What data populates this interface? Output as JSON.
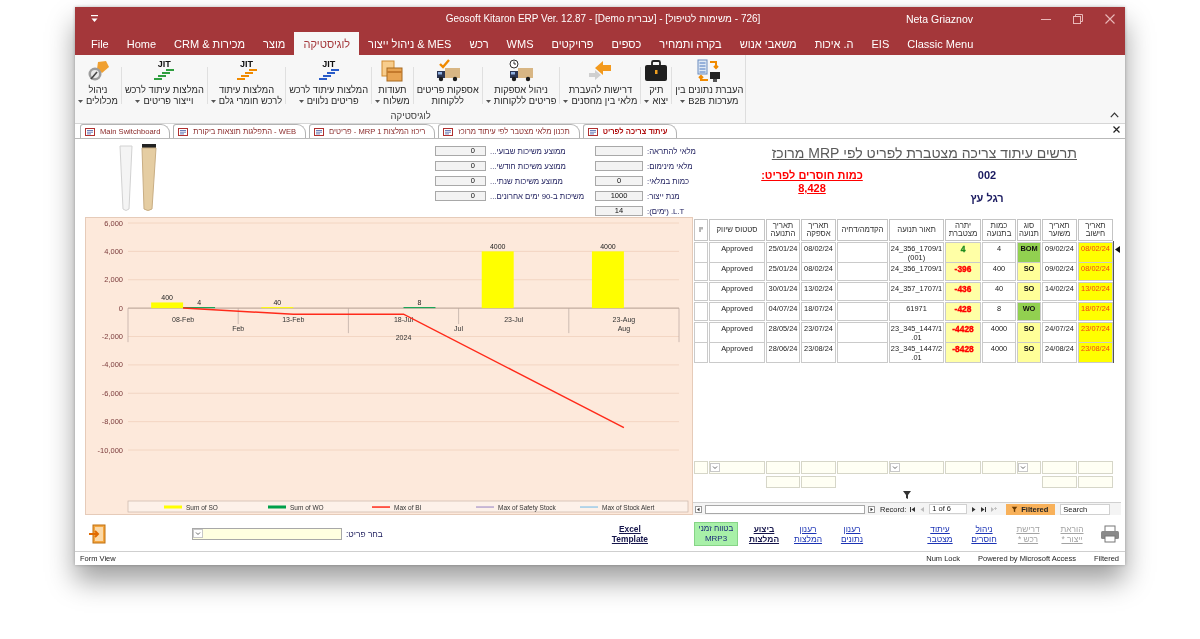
{
  "window": {
    "title": "Geosoft Kitaron ERP Ver. 12.87 - [Demo עברית] - [726 - משימות לטיפול]",
    "user": "Neta Griaznov"
  },
  "ribbon_tabs": [
    {
      "label": "Classic Menu",
      "selected": false
    },
    {
      "label": "EIS",
      "selected": false
    },
    {
      "label": "ה. איכות",
      "selected": false
    },
    {
      "label": "משאבי אנוש",
      "selected": false
    },
    {
      "label": "בקרה ותמחיר",
      "selected": false
    },
    {
      "label": "כספים",
      "selected": false
    },
    {
      "label": "פרויקטים",
      "selected": false
    },
    {
      "label": "WMS",
      "selected": false
    },
    {
      "label": "רכש",
      "selected": false
    },
    {
      "label": "ניהול ייצור & MES",
      "selected": false
    },
    {
      "label": "לוגיסטיקה",
      "selected": true
    },
    {
      "label": "מוצר",
      "selected": false
    },
    {
      "label": "CRM & מכירות",
      "selected": false
    },
    {
      "label": "Home",
      "selected": false
    },
    {
      "label": "File",
      "selected": false
    }
  ],
  "ribbon": {
    "buttons": [
      {
        "label": "העברת נתונים בין\nמערכות B2B",
        "has_menu": true
      },
      {
        "label": "תיק\nיצוא",
        "has_menu": true
      },
      {
        "label": "דרישות להעברת\nמלאי בין מחסנים",
        "has_menu": true
      },
      {
        "label": "ניהול אספקות\nפריטים ללקוחות",
        "has_menu": true
      },
      {
        "label": "אספקות פריטים\nללקוחות",
        "has_menu": false
      },
      {
        "label": "תעודות\nמשלוח",
        "has_menu": true
      },
      {
        "label": "המלצות עיתוד לרכש\nפריטים נלווים",
        "has_menu": true,
        "badge": "JIT",
        "color": "#2a5cc8"
      },
      {
        "label": "המלצות עיתוד\nלרכש חומרי גלם",
        "has_menu": true,
        "badge": "JIT",
        "color": "#f08a00"
      },
      {
        "label": "המלצות עיתוד לרכש\nוייצור פריטים",
        "has_menu": true,
        "badge": "JIT",
        "color": "#2f9e3f"
      },
      {
        "label": "ניהול\nמכלולים",
        "has_menu": true
      }
    ],
    "group_label": "לוגיסטיקה"
  },
  "doc_tabs": [
    {
      "label": "עיתוד צריכה לפריט",
      "selected": true
    },
    {
      "label": "תכנון מלאי מצטבר לפי עיתוד מרוכז",
      "selected": false
    },
    {
      "label": "ריכוז המלצות MRP 1 - פריטים",
      "selected": false
    },
    {
      "label": "WEB - התפלגות תוצאות ביקורת",
      "selected": false
    },
    {
      "label": "Main Switchboard",
      "selected": false
    }
  ],
  "usage_fields": [
    {
      "label": "ממוצע משיכות שבועי...",
      "value": "0"
    },
    {
      "label": "ממוצע משיכות חודשי...",
      "value": "0"
    },
    {
      "label": "ממוצע משיכות שנתי...",
      "value": "0"
    },
    {
      "label": "משיכות ב-90 ימים אחרונים...",
      "value": "0"
    }
  ],
  "stock_fields": [
    {
      "label": "מלאי להתראה:"
    },
    {
      "label": "מלאי מינימום:"
    },
    {
      "label": "כמות במלאי:",
      "value": "0"
    },
    {
      "label": "מנת ייצור:",
      "value": "1000"
    },
    {
      "label": "L.T. (ימים):",
      "value": "14"
    }
  ],
  "item_panel": {
    "title": "תרשים עיתוד צריכה מצטברת לפריט לפי MRP מרוכז",
    "shortage_label": "כמות חוסרים לפריט:",
    "shortage_value": "8,428",
    "item_code": "002",
    "item_name": "רגל עץ"
  },
  "chart": {
    "chart_data": {
      "type": "bar",
      "categories": [
        "08-Feb",
        "13-Feb",
        "18-Jul",
        "23-Jul",
        "23-Aug"
      ],
      "series": [
        {
          "name": "Sum of SO",
          "type": "bar",
          "color": "#ffff00",
          "values": [
            400,
            40,
            null,
            4000,
            4000
          ],
          "value_labels": [
            "400",
            "40",
            null,
            "4000",
            "4000"
          ]
        },
        {
          "name": "Sum of WO",
          "type": "bar",
          "color": "#00a04a",
          "values": [
            4,
            null,
            8,
            null,
            null
          ],
          "value_labels": [
            "4",
            null,
            "8",
            null,
            null
          ]
        },
        {
          "name": "Max of BI",
          "type": "line",
          "color": "#ff2a1a",
          "values": [
            4,
            -436,
            -428,
            -4428,
            -8428
          ]
        },
        {
          "name": "Max of Safety Stock",
          "type": "line",
          "color": "#b7a6cf",
          "values": [
            null,
            null,
            null,
            null,
            null
          ]
        },
        {
          "name": "Max of Stock Alert",
          "type": "line",
          "color": "#9ccbe8",
          "values": [
            null,
            null,
            null,
            null,
            null
          ]
        }
      ],
      "stacked": false,
      "grid": true,
      "legend": "bottom",
      "ylim": [
        -10000,
        6000
      ],
      "yticks": [
        {
          "value": 6000,
          "label": "6,000"
        },
        {
          "value": 4000,
          "label": "4,000"
        },
        {
          "value": 2000,
          "label": "2,000"
        },
        {
          "value": 0,
          "label": "0"
        },
        {
          "value": -2000,
          "label": "-2,000"
        },
        {
          "value": -4000,
          "label": "-4,000"
        },
        {
          "value": -6000,
          "label": "-6,000"
        },
        {
          "value": -8000,
          "label": "-8,000"
        },
        {
          "value": -10000,
          "label": "-10,000"
        }
      ],
      "annotations": [
        "Feb",
        "Jul",
        "Aug",
        "2024"
      ]
    }
  },
  "table": {
    "columns": [
      {
        "label": "תאריך חישוב",
        "kind": "text",
        "second_filter": true
      },
      {
        "label": "תאריך משוער",
        "kind": "text",
        "second_filter": true
      },
      {
        "label": "סוג תנועה",
        "kind": "dropdown",
        "second_filter": false
      },
      {
        "label": "כמות בתנועה",
        "kind": "text",
        "second_filter": false
      },
      {
        "label": "יתרה מצטברת",
        "kind": "text",
        "second_filter": false
      },
      {
        "label": "תאור תנועה",
        "kind": "dropdown",
        "second_filter": false
      },
      {
        "label": "הקדמה/דחיה",
        "kind": "text",
        "second_filter": false
      },
      {
        "label": "תאריך אספקה",
        "kind": "text",
        "second_filter": true
      },
      {
        "label": "תאריך התנועה",
        "kind": "text",
        "second_filter": true
      },
      {
        "label": "סטטוס שיווק",
        "kind": "dropdown",
        "second_filter": false
      },
      {
        "label": "יו",
        "kind": "text",
        "second_filter": false
      }
    ],
    "rows": [
      {
        "selected": true,
        "calc_date": "08/02/24",
        "estimated_date": "09/02/24",
        "type": {
          "text": "BOM",
          "color": "#92d050"
        },
        "quantity": "4",
        "balance": {
          "text": "4",
          "color": "#1e8a1e"
        },
        "description": "24_356_1709/1 (001)",
        "supply_date": "08/02/24",
        "movement_date": "25/01/24",
        "marketing_status": "Approved"
      },
      {
        "selected": false,
        "calc_date": "08/02/24",
        "estimated_date": "09/02/24",
        "type": {
          "text": "SO",
          "color": "#ffff99"
        },
        "quantity": "400",
        "balance": {
          "text": "-396",
          "color": "#ff0000"
        },
        "description": "24_356_1709/1",
        "supply_date": "08/02/24",
        "movement_date": "25/01/24",
        "marketing_status": "Approved"
      },
      {
        "selected": false,
        "calc_date": "13/02/24",
        "estimated_date": "14/02/24",
        "type": {
          "text": "SO",
          "color": "#ffff99"
        },
        "quantity": "40",
        "balance": {
          "text": "-436",
          "color": "#ff0000"
        },
        "description": "24_357_1707/1",
        "supply_date": "13/02/24",
        "movement_date": "30/01/24",
        "marketing_status": "Approved"
      },
      {
        "selected": false,
        "calc_date": "18/07/24",
        "type": {
          "text": "WO",
          "color": "#92d050"
        },
        "quantity": "8",
        "balance": {
          "text": "-428",
          "color": "#ff0000"
        },
        "description": "61971",
        "supply_date": "18/07/24",
        "movement_date": "04/07/24",
        "marketing_status": "Approved"
      },
      {
        "selected": false,
        "calc_date": "23/07/24",
        "estimated_date": "24/07/24",
        "type": {
          "text": "SO",
          "color": "#ffff99"
        },
        "quantity": "4000",
        "balance": {
          "text": "-4428",
          "color": "#ff0000"
        },
        "description": "23_345_1447/1.01",
        "supply_date": "23/07/24",
        "movement_date": "28/05/24",
        "marketing_status": "Approved"
      },
      {
        "selected": false,
        "calc_date": "23/08/24",
        "estimated_date": "24/08/24",
        "type": {
          "text": "SO",
          "color": "#ffff99"
        },
        "quantity": "4000",
        "balance": {
          "text": "-8428",
          "color": "#ff0000"
        },
        "description": "23_345_1447/2.01",
        "supply_date": "23/08/24",
        "movement_date": "28/06/24",
        "marketing_status": "Approved"
      }
    ],
    "navigation": {
      "label": "Record:",
      "position": "1 of 6",
      "filter_state": "Filtered",
      "search_placeholder": "Search"
    }
  },
  "bottom_bar": {
    "groups": [
      [
        {
          "label": "הוראת\nייצור *",
          "kind": "link",
          "disabled": true
        },
        {
          "label": "דרישת\nרכש *",
          "kind": "link",
          "disabled": true
        },
        {
          "label": "ניהול\nחוסרים",
          "kind": "link",
          "disabled": false
        },
        {
          "label": "עיתוד\nמצטבר",
          "kind": "link",
          "disabled": false
        }
      ],
      [
        {
          "label": "רענון\nנתונים",
          "kind": "link",
          "disabled": false
        },
        {
          "label": "רענון\nהמלצות",
          "kind": "link",
          "disabled": false
        },
        {
          "label": "ביצוע\nהמלצות",
          "kind": "strong",
          "disabled": false
        },
        {
          "label": "בטווח זמני\nMRP3",
          "kind": "highlight",
          "disabled": false
        }
      ],
      [
        {
          "label": "Excel\nTemplate",
          "kind": "strong",
          "disabled": false
        }
      ]
    ],
    "picker_label": "בחר פריט:"
  },
  "status_bar": {
    "view": "Form View",
    "indicators": [
      "Filtered",
      "Powered by Microsoft Access",
      "Num Lock"
    ]
  }
}
